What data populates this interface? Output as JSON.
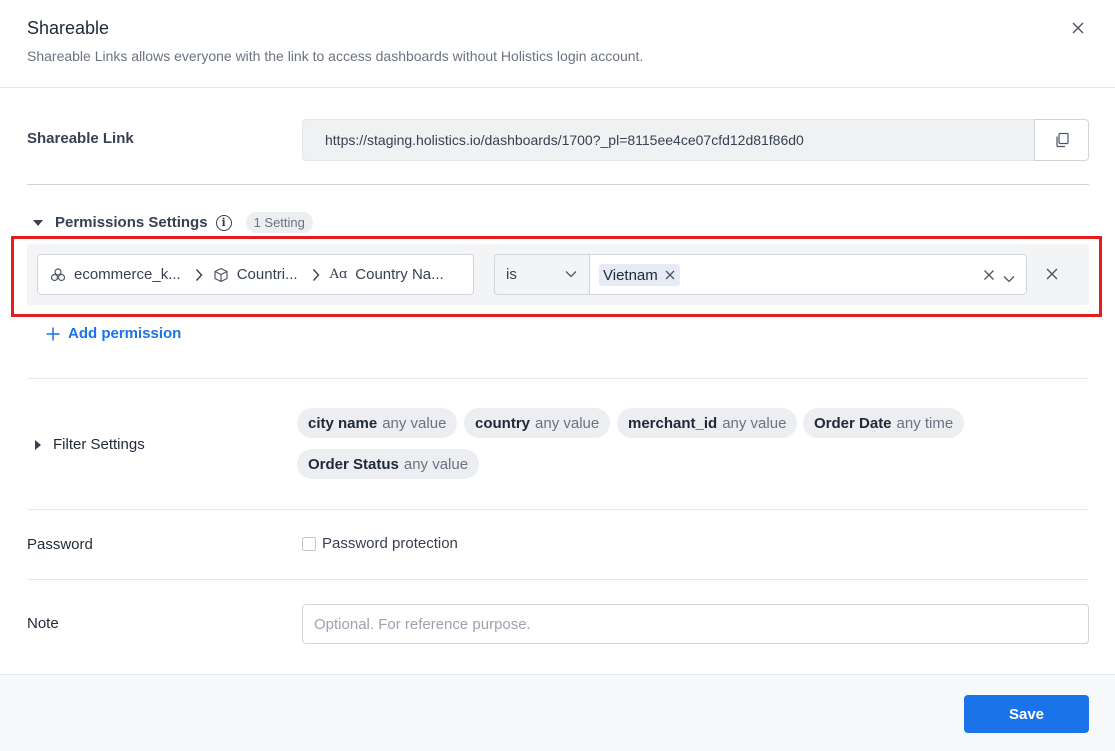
{
  "header": {
    "title": "Shareable",
    "subtitle": "Shareable Links allows everyone with the link to access dashboards without Holistics login account."
  },
  "shareable_link": {
    "label": "Shareable Link",
    "url": "https://staging.holistics.io/dashboards/1700?_pl=8115ee4ce07cfd12d81f86d0"
  },
  "permissions": {
    "title": "Permissions Settings",
    "count_badge": "1 Setting",
    "rule": {
      "path": [
        {
          "icon": "dataset-icon",
          "label": "ecommerce_k..."
        },
        {
          "icon": "model-cube-icon",
          "label": "Countri..."
        },
        {
          "icon": "text-field-icon",
          "label": "Country Na..."
        }
      ],
      "operator": "is",
      "values": [
        "Vietnam"
      ]
    },
    "add_label": "Add permission"
  },
  "filters": {
    "title": "Filter Settings",
    "items": [
      {
        "name": "city name",
        "value": "any value"
      },
      {
        "name": "country",
        "value": "any value"
      },
      {
        "name": "merchant_id",
        "value": "any value"
      },
      {
        "name": "Order Date",
        "value": "any time"
      },
      {
        "name": "Order Status",
        "value": "any value"
      }
    ]
  },
  "password": {
    "label": "Password",
    "checkbox_label": "Password protection"
  },
  "note": {
    "label": "Note",
    "placeholder": "Optional. For reference purpose."
  },
  "footer": {
    "save_label": "Save"
  },
  "colors": {
    "primary": "#1a73e8",
    "highlight": "#e11d1d"
  }
}
